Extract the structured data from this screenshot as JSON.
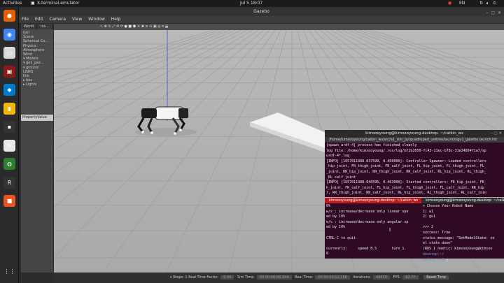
{
  "topbar": {
    "activities": "Activities",
    "app_name": "X-terminal-emulator",
    "datetime": "Jul 5  18:07",
    "lang": "EN"
  },
  "dock": {
    "items": [
      {
        "name": "firefox-icon",
        "color": "#e66000",
        "glyph": "●"
      },
      {
        "name": "chrome-icon",
        "color": "#4285f4",
        "glyph": "◉"
      },
      {
        "name": "files-icon",
        "color": "#d9d9d9",
        "glyph": "▭"
      },
      {
        "name": "terminal-icon",
        "color": "#8b1a1a",
        "glyph": "▣"
      },
      {
        "name": "vscode-icon",
        "color": "#007acc",
        "glyph": "◆"
      },
      {
        "name": "notes-icon",
        "color": "#f2b705",
        "glyph": "▮"
      },
      {
        "name": "terminal-small-icon",
        "color": "#333333",
        "glyph": "▪"
      },
      {
        "name": "editor-icon",
        "color": "#e8e8e8",
        "glyph": "✎"
      },
      {
        "name": "globe-icon",
        "color": "#2e7d32",
        "glyph": "◍"
      },
      {
        "name": "rviz-icon",
        "color": "#333333",
        "glyph": "R"
      },
      {
        "name": "package-icon",
        "color": "#e95420",
        "glyph": "■"
      },
      {
        "name": "app-grid-icon",
        "color": "#2a2a2a",
        "glyph": "⋮⋮"
      }
    ]
  },
  "gazebo": {
    "title": "Gazebo",
    "menu": [
      "File",
      "Edit",
      "Camera",
      "View",
      "Window",
      "Help"
    ],
    "tabs": [
      "World",
      "Ins..."
    ],
    "tree": [
      "GUI",
      "Scene",
      "Spherical Co...",
      "Physics",
      "Atmosphere",
      "Wind",
      "▾ Models",
      "   ▾ go1_gaz...",
      "     ▾ ground",
      "        LINKS",
      "        link",
      "   ▸ box",
      "▸ Lights"
    ],
    "prop_header": "PropertyValue",
    "status": {
      "steps_label": "Steps: 1",
      "rtf_label": "Real Time Factor:",
      "rtf_value": "0.99",
      "sim_label": "Sim Time:",
      "sim_value": "00 00:00:08.444",
      "real_label": "Real Time:",
      "real_value": "00 00:00:12.150",
      "iter_label": "Iterations:",
      "iter_value": "49449",
      "fps_label": "FPS:",
      "fps_value": "62.77",
      "reset_label": "Reset Time"
    }
  },
  "term1": {
    "title": "kimsooyoung@kimsooyoung-desktop: ~/catkin_ws",
    "tab": "/home/kimsooyoung/catkin_ws/src/a1_sim_py/quadruped_unitree/launch/go1_gazebo.launch.htt",
    "lines": [
      "[spawn_urdf-4] process has finished cleanly",
      "log file: /home/kimsooyoung/.ros/log/bf2b2050-fc43-11ec-b78c-31e24804f1a7/sp",
      "urdf-4*.log",
      "[INFO] [1657011988.637599, 0.460000]: Controller Spawner: Loaded controllers",
      "_hip_joint, FR_thigh_joint, FR_calf_joint, FL_hip_joint, FL_thigh_joint, FL_",
      "_joint, RR_hip_joint, RR_thigh_joint, RR_calf_joint, RL_hip_joint, RL_thigh_",
      "_RL_calf_joint",
      "[INFO] [1657011988.640595, 0.463000]: Started controllers: FR_hip_joint, FR_",
      "h_joint, FR_calf_joint, FL_hip_joint, FL_thigh_joint, FL_calf_joint, RR_hip",
      "t, RR_thigh_joint, RR_calf_joint, RL_hip_joint, RL_thigh_joint, RL_calf_join"
    ]
  },
  "term2": {
    "tab": "kimsooyoung@kimsooyoung-desktop: ~/catkin_ws",
    "lines": [
      "0%",
      "w/x : increase/decrease only linear spe",
      "ed by 10%",
      "e/c : increase/decrease only angular sp",
      "ed by 10%",
      "",
      "CTRL-C to quit",
      "",
      "currently:     speed 0.5       turn 1.",
      "0"
    ]
  },
  "term3": {
    "tab": "kimsooyoung@kimsooyoung-desktop: ~/catkin_ws",
    "lines": [
      "> Choose Your Robot Name",
      "1) a1",
      "2) go1",
      "",
      ">>> 2",
      "success: True",
      "status_message: \"SetModelState: se",
      "el state done\"",
      "(ROS 1 noetic) kimsooyoung@kimsoo"
    ],
    "prompt_host": "desktop:~/",
    "prompt_dir": "catkin_ws$"
  }
}
